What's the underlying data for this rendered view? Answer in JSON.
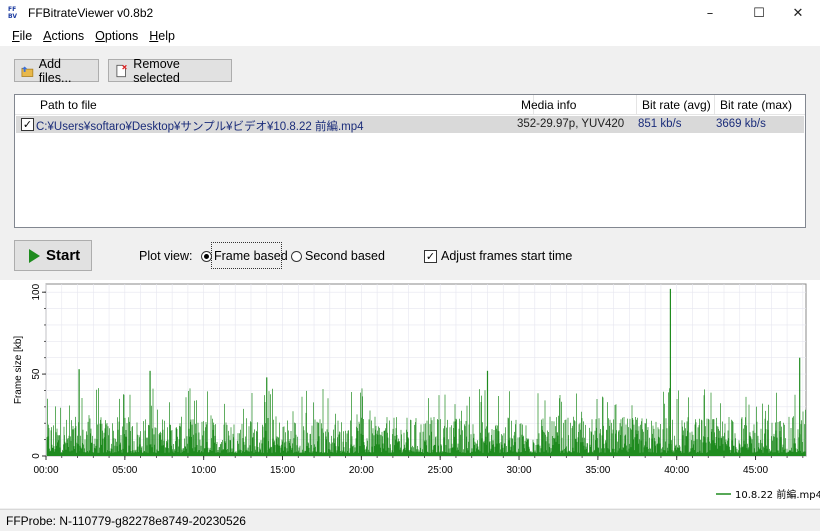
{
  "window": {
    "title": "FFBitrateViewer v0.8b2",
    "icon_text": "FFBV"
  },
  "menu": [
    {
      "underline": "F",
      "rest": "ile"
    },
    {
      "underline": "A",
      "rest": "ctions"
    },
    {
      "underline": "O",
      "rest": "ptions"
    },
    {
      "underline": "H",
      "rest": "elp"
    }
  ],
  "toolbar": {
    "add_files_label": "Add files...",
    "remove_selected_label": "Remove selected"
  },
  "file_list": {
    "columns": [
      "Path to file",
      "Media info",
      "Bit rate (avg)",
      "Bit rate (max)"
    ],
    "rows": [
      {
        "checked": true,
        "path": "C:¥Users¥softaro¥Desktop¥サンプル¥ビデオ¥10.8.22 前編.mp4",
        "media_info": "352-29.97p, YUV420",
        "bitrate_avg": "851 kb/s",
        "bitrate_max": "3669 kb/s"
      }
    ]
  },
  "controls": {
    "start_label": "Start",
    "plot_view_label": "Plot view:",
    "frame_based_label": "Frame based",
    "second_based_label": "Second based",
    "plot_view_selected": "frame",
    "adjust_label": "Adjust frames start time",
    "adjust_checked": true
  },
  "chart_data": {
    "type": "line",
    "ylabel": "Frame size [kb]",
    "xlabel": "",
    "xlim": [
      0,
      48.2
    ],
    "ylim": [
      0,
      105
    ],
    "x_unit": "minutes",
    "x_ticks": [
      "00:00",
      "05:00",
      "10:00",
      "15:00",
      "20:00",
      "25:00",
      "30:00",
      "35:00",
      "40:00",
      "45:00"
    ],
    "x_tick_values": [
      0,
      5,
      10,
      15,
      20,
      25,
      30,
      35,
      40,
      45
    ],
    "y_ticks": [
      "0",
      "50",
      "100"
    ],
    "y_tick_values": [
      0,
      50,
      100
    ],
    "grid": true,
    "legend_position": "bottom-right",
    "series": [
      {
        "name": "10.8.22 前編.mp4",
        "color": "#1f8b1f",
        "peaks": [
          {
            "x": 2.1,
            "y": 53
          },
          {
            "x": 6.6,
            "y": 52
          },
          {
            "x": 14.0,
            "y": 48
          },
          {
            "x": 28.0,
            "y": 52
          },
          {
            "x": 39.6,
            "y": 102
          },
          {
            "x": 47.8,
            "y": 60
          }
        ]
      }
    ]
  },
  "status": {
    "text": "FFProbe: N-110779-g82278e8749-20230526"
  }
}
